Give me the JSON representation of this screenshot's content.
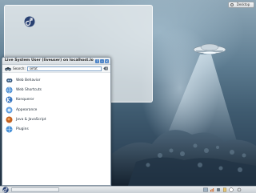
{
  "colors": {
    "accent": "#4d84c7",
    "wallpaper_top": "#8ea7b7",
    "wallpaper_bottom": "#23364a",
    "panel": "#dce1e5"
  },
  "desktop": {
    "toolbox_label": "Desktop",
    "icons": [
      {
        "label": "",
        "icon": "fedora-icon"
      }
    ]
  },
  "window": {
    "title": "Live System User (liveuser) on localhost.lo",
    "search": {
      "label": "Search:",
      "value": "sefat",
      "placeholder": ""
    },
    "items": [
      {
        "label": "Web Behavior",
        "icon": "web-behavior-icon"
      },
      {
        "label": "Web Shortcuts",
        "icon": "web-shortcuts-icon"
      },
      {
        "label": "Konqueror",
        "icon": "konqueror-icon"
      },
      {
        "label": "Appearance",
        "icon": "appearance-icon"
      },
      {
        "label": "Java & JavaScript",
        "icon": "java-icon"
      },
      {
        "label": "Plugins",
        "icon": "plugins-icon"
      }
    ]
  },
  "panel": {
    "launcher": "fedora-icon",
    "clock": ""
  }
}
